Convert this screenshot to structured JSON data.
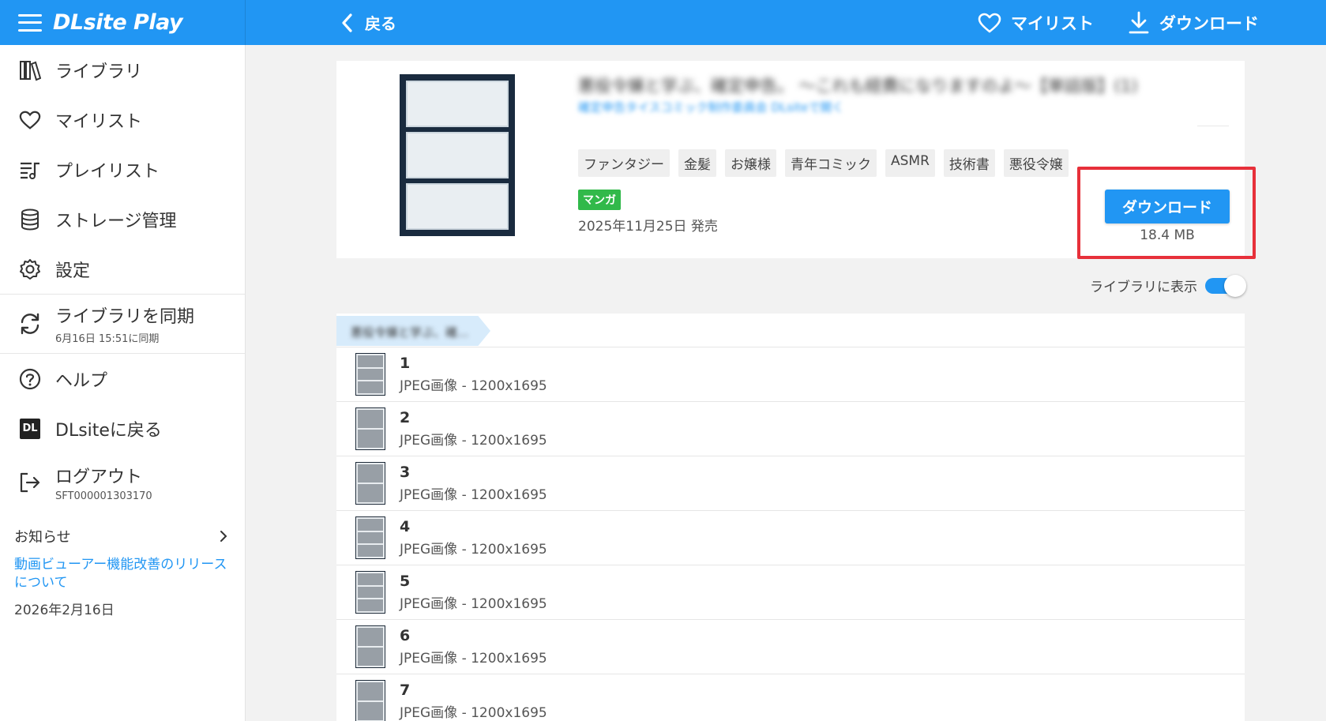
{
  "header": {
    "brand": "DLsite Play",
    "back_label": "戻る",
    "mylist_label": "マイリスト",
    "download_label": "ダウンロード"
  },
  "sidebar": {
    "items": [
      {
        "label": "ライブラリ",
        "icon": "library-icon"
      },
      {
        "label": "マイリスト",
        "icon": "heart-icon"
      },
      {
        "label": "プレイリスト",
        "icon": "playlist-icon"
      },
      {
        "label": "ストレージ管理",
        "icon": "storage-icon"
      },
      {
        "label": "設定",
        "icon": "gear-icon"
      }
    ],
    "sync": {
      "label": "ライブラリを同期",
      "sub": "6月16日 15:51に同期"
    },
    "help": "ヘルプ",
    "dlsite_return": "DLsiteに戻る",
    "dl_badge": "DL",
    "logout": {
      "label": "ログアウト",
      "sub": "SFT000001303170"
    },
    "news": {
      "heading": "お知らせ",
      "link": "動画ビューアー機能改善のリリースについて",
      "date": "2026年2月16日"
    }
  },
  "work": {
    "title": "悪役令嬢と学ぶ、確定申告。 〜これも経費になりますのよ〜【単話版】(1)",
    "circle": "確定申告タイスコミック制作委員会 DLsiteで開く",
    "tags": [
      "ファンタジー",
      "金髪",
      "お嬢様",
      "青年コミック",
      "ASMR",
      "技術書",
      "悪役令嬢"
    ],
    "category": "マンガ",
    "release": "2025年11月25日 発売",
    "download_button": "ダウンロード",
    "size": "18.4 MB"
  },
  "library_toggle": {
    "label": "ライブラリに表示",
    "on": true
  },
  "folder": "悪役令嬢と学ぶ、確...",
  "files": [
    {
      "num": "1",
      "meta": "JPEG画像 - 1200x1695"
    },
    {
      "num": "2",
      "meta": "JPEG画像 - 1200x1695"
    },
    {
      "num": "3",
      "meta": "JPEG画像 - 1200x1695"
    },
    {
      "num": "4",
      "meta": "JPEG画像 - 1200x1695"
    },
    {
      "num": "5",
      "meta": "JPEG画像 - 1200x1695"
    },
    {
      "num": "6",
      "meta": "JPEG画像 - 1200x1695"
    },
    {
      "num": "7",
      "meta": "JPEG画像 - 1200x1695"
    }
  ],
  "colors": {
    "accent": "#2196f3",
    "highlight": "#e7303a",
    "category": "#31b94a"
  }
}
